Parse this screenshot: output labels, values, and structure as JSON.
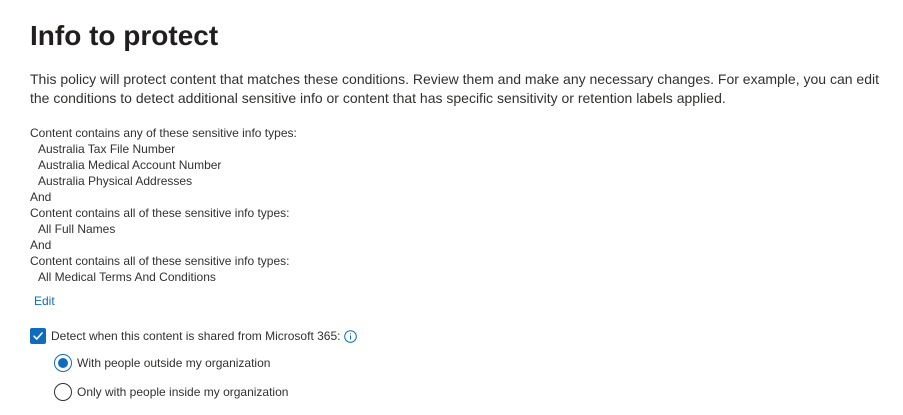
{
  "page": {
    "title": "Info to protect",
    "description": "This policy will protect content that matches these conditions. Review them and make any necessary changes. For example, you can edit the conditions to detect additional sensitive info or content that has specific sensitivity or retention labels applied."
  },
  "conditions": {
    "lines": [
      {
        "text": "Content contains any of these sensitive info types:",
        "indent": false
      },
      {
        "text": "Australia Tax File Number",
        "indent": true
      },
      {
        "text": "Australia Medical Account Number",
        "indent": true
      },
      {
        "text": "Australia Physical Addresses",
        "indent": true
      },
      {
        "text": "And",
        "indent": false
      },
      {
        "text": "Content contains all of these sensitive info types:",
        "indent": false
      },
      {
        "text": "All Full Names",
        "indent": true
      },
      {
        "text": "And",
        "indent": false
      },
      {
        "text": "Content contains all of these sensitive info types:",
        "indent": false
      },
      {
        "text": "All Medical Terms And Conditions",
        "indent": true
      }
    ],
    "edit_label": "Edit"
  },
  "detect_shared": {
    "label": "Detect when this content is shared from Microsoft 365:",
    "checked": true,
    "info_icon": "info-icon",
    "options": [
      {
        "label": "With people outside my organization",
        "selected": true
      },
      {
        "label": "Only with people inside my organization",
        "selected": false
      }
    ]
  },
  "colors": {
    "accent": "#0f6cbd",
    "text": "#323130",
    "title": "#201f1e"
  }
}
